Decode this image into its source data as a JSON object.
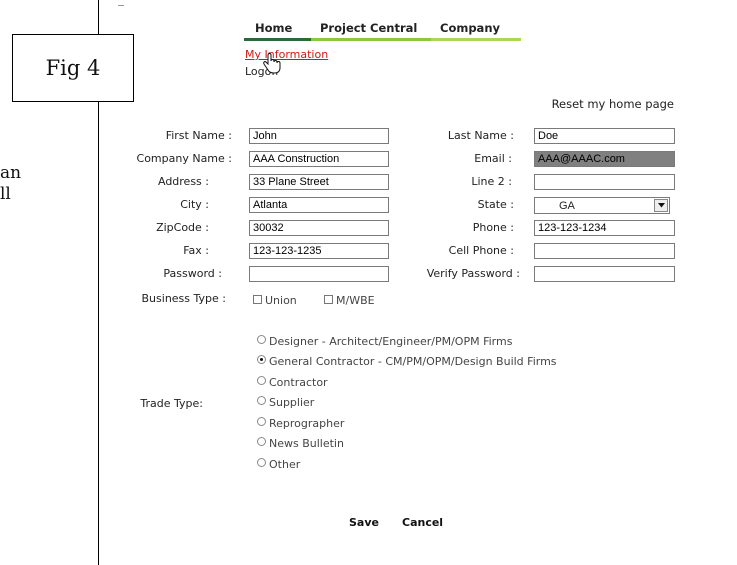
{
  "doc_fragments": [
    "an",
    "ll"
  ],
  "figure_label": "Fig 4",
  "nav": {
    "tabs": [
      {
        "label": "Home",
        "bar_color": "#2a6a3a"
      },
      {
        "label": "Project Central",
        "bar_color": "#8ac83c"
      },
      {
        "label": "Company",
        "bar_color": "#a7d85a"
      }
    ],
    "submenu": {
      "my_information": "My Information",
      "logoff": "Logoff"
    }
  },
  "reset_link": "Reset my home page",
  "form": {
    "first_name": {
      "label": "First Name :",
      "value": "John"
    },
    "last_name": {
      "label": "Last Name :",
      "value": "Doe"
    },
    "company_name": {
      "label": "Company Name :",
      "value": "AAA Construction"
    },
    "email": {
      "label": "Email :",
      "value": "AAA@AAAC.com"
    },
    "address": {
      "label": "Address :",
      "value": "33 Plane Street"
    },
    "line2": {
      "label": "Line 2 :",
      "value": ""
    },
    "city": {
      "label": "City :",
      "value": "Atlanta"
    },
    "state": {
      "label": "State :",
      "value": "GA"
    },
    "zipcode": {
      "label": "ZipCode :",
      "value": "30032"
    },
    "phone": {
      "label": "Phone :",
      "value": "123-123-1234"
    },
    "fax": {
      "label": "Fax :",
      "value": "123-123-1235"
    },
    "cell_phone": {
      "label": "Cell Phone :",
      "value": ""
    },
    "password": {
      "label": "Password :",
      "value": ""
    },
    "verify_password": {
      "label": "Verify Password :",
      "value": ""
    },
    "business_type": {
      "label": "Business Type :",
      "options": [
        "Union",
        "M/WBE"
      ]
    },
    "trade_type": {
      "label": "Trade Type:",
      "options": [
        "Designer - Architect/Engineer/PM/OPM Firms",
        "General Contractor - CM/PM/OPM/Design Build Firms",
        "Contractor",
        "Supplier",
        "Reprographer",
        "News Bulletin",
        "Other"
      ],
      "selected": "General Contractor - CM/PM/OPM/Design Build Firms"
    }
  },
  "buttons": {
    "save": "Save",
    "cancel": "Cancel"
  },
  "colors": {
    "link_red": "#d01818",
    "email_fill": "#808080"
  }
}
